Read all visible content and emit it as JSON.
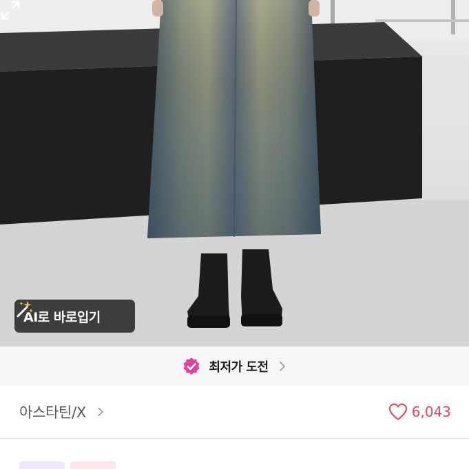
{
  "photo": {
    "alt_label": "",
    "ai_button": {
      "label": "AI로 바로입기",
      "icon": "magic-wand-icon"
    },
    "expand_icon": "expand-icon"
  },
  "price_banner": {
    "label": "최저가 도전",
    "badge_icon": "check-badge-icon",
    "badge_color": "#e040a0"
  },
  "shop": {
    "name": "아스타틴/X",
    "likes": "6,043",
    "heart_color": "#e2475e"
  },
  "tags": [
    {
      "label": "",
      "style": "purple"
    },
    {
      "label": "",
      "style": "pink"
    }
  ]
}
